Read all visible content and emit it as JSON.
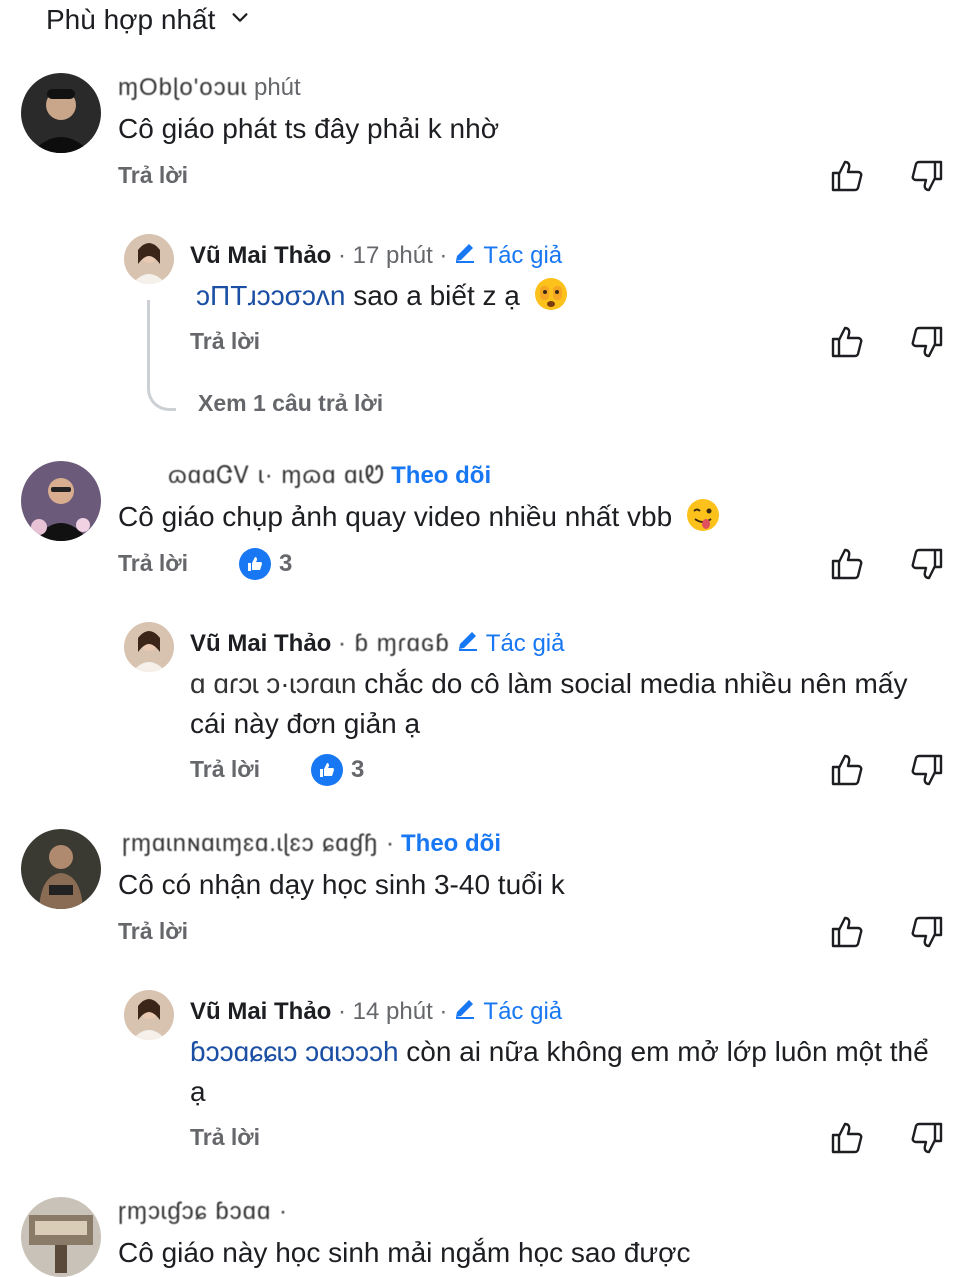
{
  "sort": {
    "label": "Phù hợp nhất"
  },
  "comments": [
    {
      "meta_obscured": "ɱObɭo'oɔuɩ",
      "time": "phút",
      "text": "Cô giáo phát ts đây phải k nhờ",
      "reply_label": "Trả lời",
      "reply": {
        "name": "Vũ Mai Thảo",
        "time": "· 17 phút ·",
        "author_label": "Tác giả",
        "mention": "ɔΠΤɹɔɔσɔʌn",
        "text": "sao a biết z ạ",
        "emoji": "face-with-peeking-eye",
        "reply_label": "Trả lời",
        "view_more": "Xem 1 câu trả lời"
      }
    },
    {
      "meta_obscured": "ɷɑɑᏣᏙ ɩ·  ɱɷɑ ɑɩᏬ",
      "follow_label": "Theo dõi",
      "text": "Cô giáo chụp ảnh quay video nhiều nhất vbb",
      "emoji": "winking-face-with-tongue",
      "reply_label": "Trả lời",
      "like_count": "3",
      "reply": {
        "name": "Vũ Mai Thảo",
        "time": "· ɓ ɱɾɑɢɓ",
        "author_label": "Tác giả",
        "mention": "ɑ ɑɾɔɩ ɔ·ɩɔɾɑɩn",
        "text": "chắc do cô làm social media nhiều nên mấy cái này đơn giản ạ",
        "reply_label": "Trả lời",
        "like_count": "3"
      }
    },
    {
      "meta_obscured": "ɼɱɑɩnɴɑɩɱɛɑ.ɩɭɛɔ ɕɑɠɧ ·",
      "follow_label": "Theo dõi",
      "text": "Cô có nhận dạy học sinh 3-40 tuổi k",
      "reply_label": "Trả lời",
      "reply": {
        "name": "Vũ Mai Thảo",
        "time": "· 14 phút ·",
        "author_label": "Tác giả",
        "mention": "ɓɔɔɑɕɕɩɔ ɔɑɩɔɔɔh",
        "text": "còn ai nữa không em mở lớp luôn một thể ạ",
        "reply_label": "Trả lời"
      }
    },
    {
      "meta_obscured": "ɼɱɔɩɠɔɕ   ɓɔɑɑ     ·",
      "text": "Cô giáo này học sinh mải ngắm học sao được"
    }
  ],
  "colors": {
    "accent": "#1877f2",
    "muted": "#65676b",
    "text": "#1c1e21"
  }
}
